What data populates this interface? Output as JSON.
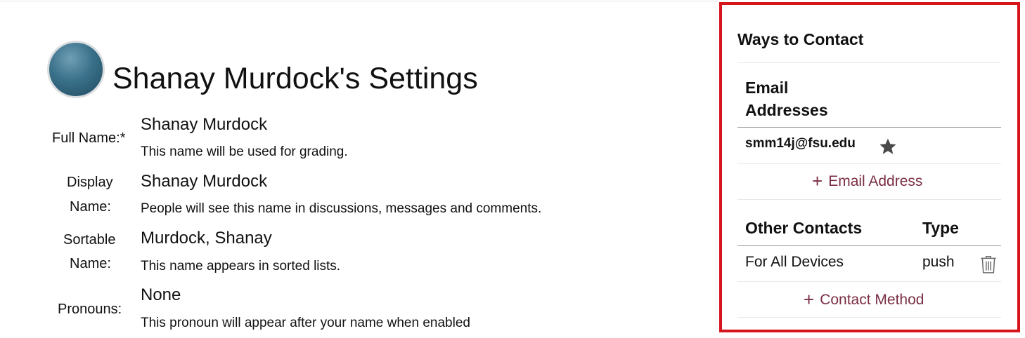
{
  "page": {
    "title": "Shanay Murdock's Settings"
  },
  "profile": {
    "fields": [
      {
        "label": "Full Name:*",
        "value": "Shanay Murdock",
        "hint": "This name will be used for grading."
      },
      {
        "label_line1": "Display",
        "label_line2": "Name:",
        "value": "Shanay Murdock",
        "hint": "People will see this name in discussions, messages and comments."
      },
      {
        "label_line1": "Sortable",
        "label_line2": "Name:",
        "value": "Murdock, Shanay",
        "hint": "This name appears in sorted lists."
      },
      {
        "label": "Pronouns:",
        "value": "None",
        "hint": "This pronoun will appear after your name when enabled"
      }
    ]
  },
  "contact": {
    "title": "Ways to Contact",
    "email_header_line1": "Email",
    "email_header_line2": "Addresses",
    "emails": [
      {
        "address": "smm14j@fsu.edu",
        "icon": "star-icon"
      }
    ],
    "add_email_label": "Email Address",
    "other_header": "Other Contacts",
    "type_header": "Type",
    "others": [
      {
        "name": "For All Devices",
        "type": "push",
        "icon": "trash-icon"
      }
    ],
    "add_contact_label": "Contact Method"
  },
  "colors": {
    "highlight_border": "#d6141c",
    "link": "#7a2e44"
  }
}
